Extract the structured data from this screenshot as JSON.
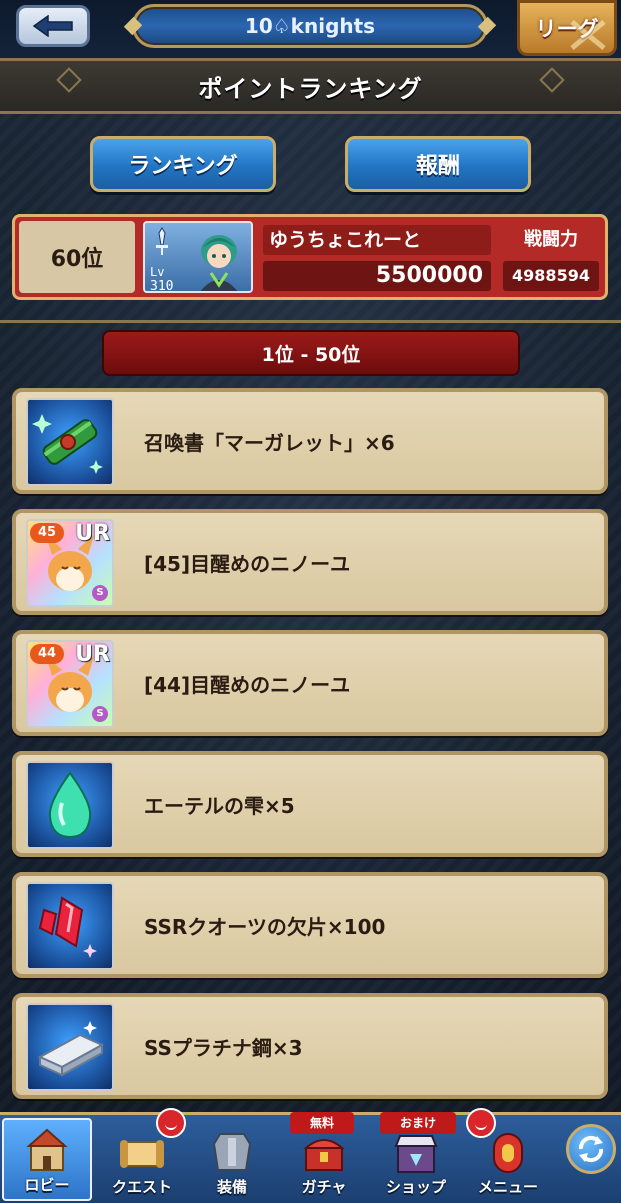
{
  "header": {
    "back_icon": "back-arrow-icon",
    "team_name": "10♤knights",
    "league_label": "リーグ"
  },
  "page": {
    "title": "ポイントランキング"
  },
  "tabs": [
    {
      "label": "ランキング"
    },
    {
      "label": "報酬"
    }
  ],
  "my_rank": {
    "rank": "60位",
    "lv_label": "Lv",
    "level": "310",
    "name": "ゆうちょこれーと",
    "points": "5500000",
    "power_label": "戦闘力",
    "power": "4988594"
  },
  "reward_section": {
    "range": "1位 - 50位",
    "rewards": [
      {
        "label": "召喚書「マーガレット」×6",
        "icon": "summon-scroll-icon"
      },
      {
        "label": "[45]目醒めのニノーユ",
        "icon": "ninoyu-card-icon",
        "badge_level": "45",
        "rarity": "UR",
        "s_mark": "S"
      },
      {
        "label": "[44]目醒めのニノーユ",
        "icon": "ninoyu-card-icon",
        "badge_level": "44",
        "rarity": "UR",
        "s_mark": "S"
      },
      {
        "label": "エーテルの雫×5",
        "icon": "ether-drop-icon"
      },
      {
        "label": "SSRクオーツの欠片×100",
        "icon": "quartz-shard-icon"
      },
      {
        "label": "SSプラチナ鋼×3",
        "icon": "platinum-ingot-icon"
      }
    ]
  },
  "bottom_nav": {
    "items": [
      {
        "label": "ロビー",
        "icon": "castle-icon"
      },
      {
        "label": "クエスト",
        "icon": "quest-scroll-icon"
      },
      {
        "label": "装備",
        "icon": "armor-icon"
      },
      {
        "label": "ガチャ",
        "icon": "treasure-chest-icon"
      },
      {
        "label": "ショップ",
        "icon": "shop-icon"
      },
      {
        "label": "メニュー",
        "icon": "menu-icon"
      }
    ],
    "tag_free": "無料",
    "tag_bonus": "おまけ",
    "refresh_icon": "refresh-icon"
  },
  "colors": {
    "accent_gold": "#c9ad6b",
    "card_red": "#b32a26",
    "row_beige": "#e6d8b7",
    "button_blue": "#2275c4"
  }
}
